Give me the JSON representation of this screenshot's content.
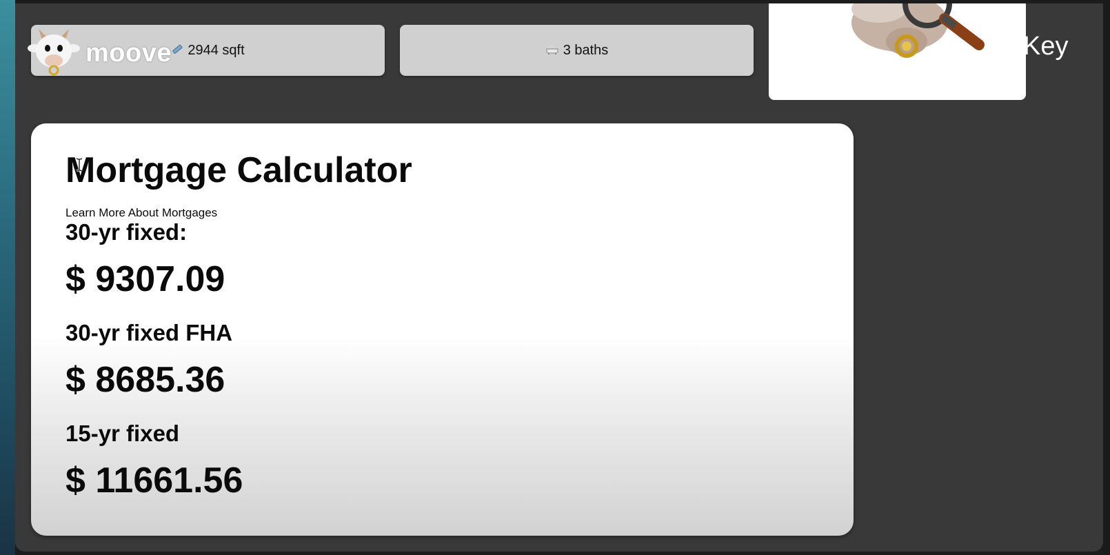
{
  "header": {
    "logo_text": "moove",
    "key_text": "Key"
  },
  "stats": {
    "sqft": {
      "icon": "ruler-icon",
      "label": "2944 sqft"
    },
    "baths": {
      "icon": "bathtub-icon",
      "label": "3 baths"
    }
  },
  "calculator": {
    "title": "Mortgage Calculator",
    "learn_more": "Learn More About Mortgages",
    "rates": [
      {
        "label": "30-yr fixed:",
        "value": "$ 9307.09"
      },
      {
        "label": "30-yr fixed FHA",
        "value": "$ 8685.36"
      },
      {
        "label": "15-yr fixed",
        "value": "$ 11661.56"
      }
    ]
  },
  "colors": {
    "page_bg": "#393939",
    "card_bg": "#ffffff",
    "stat_card_bg": "#d0d0d0",
    "accent_teal": "#3b8f9e"
  }
}
